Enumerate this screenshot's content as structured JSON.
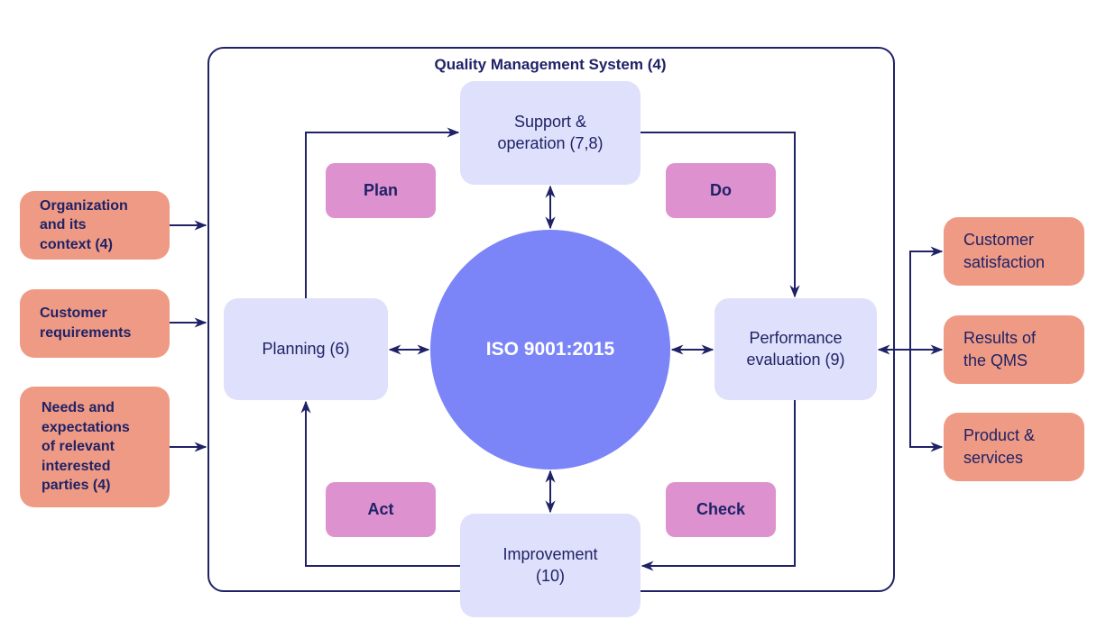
{
  "diagram": {
    "title": "Quality Management System (4)",
    "hub": {
      "label": "ISO 9001:2015",
      "color": "#7b85f7"
    },
    "processes": {
      "support": "Support &\noperation (7,8)",
      "planning": "Planning (6)",
      "performance": "Performance\nevaluation (9)",
      "improvement": "Improvement\n(10)"
    },
    "pdca": {
      "plan": "Plan",
      "do": "Do",
      "act": "Act",
      "check": "Check"
    },
    "inputs": [
      "Organization\nand its\ncontext (4)",
      "Customer\nrequirements",
      "Needs and\nexpectations\nof relevant\ninterested\nparties (4)"
    ],
    "outputs": [
      "Customer\nsatisfaction",
      "Results of\nthe QMS",
      "Product &\nservices"
    ],
    "colors": {
      "line": "#1f2266",
      "process_fill": "#dfe0fb",
      "pdca_fill": "#dd92cf",
      "io_fill": "#ef9a84"
    }
  }
}
